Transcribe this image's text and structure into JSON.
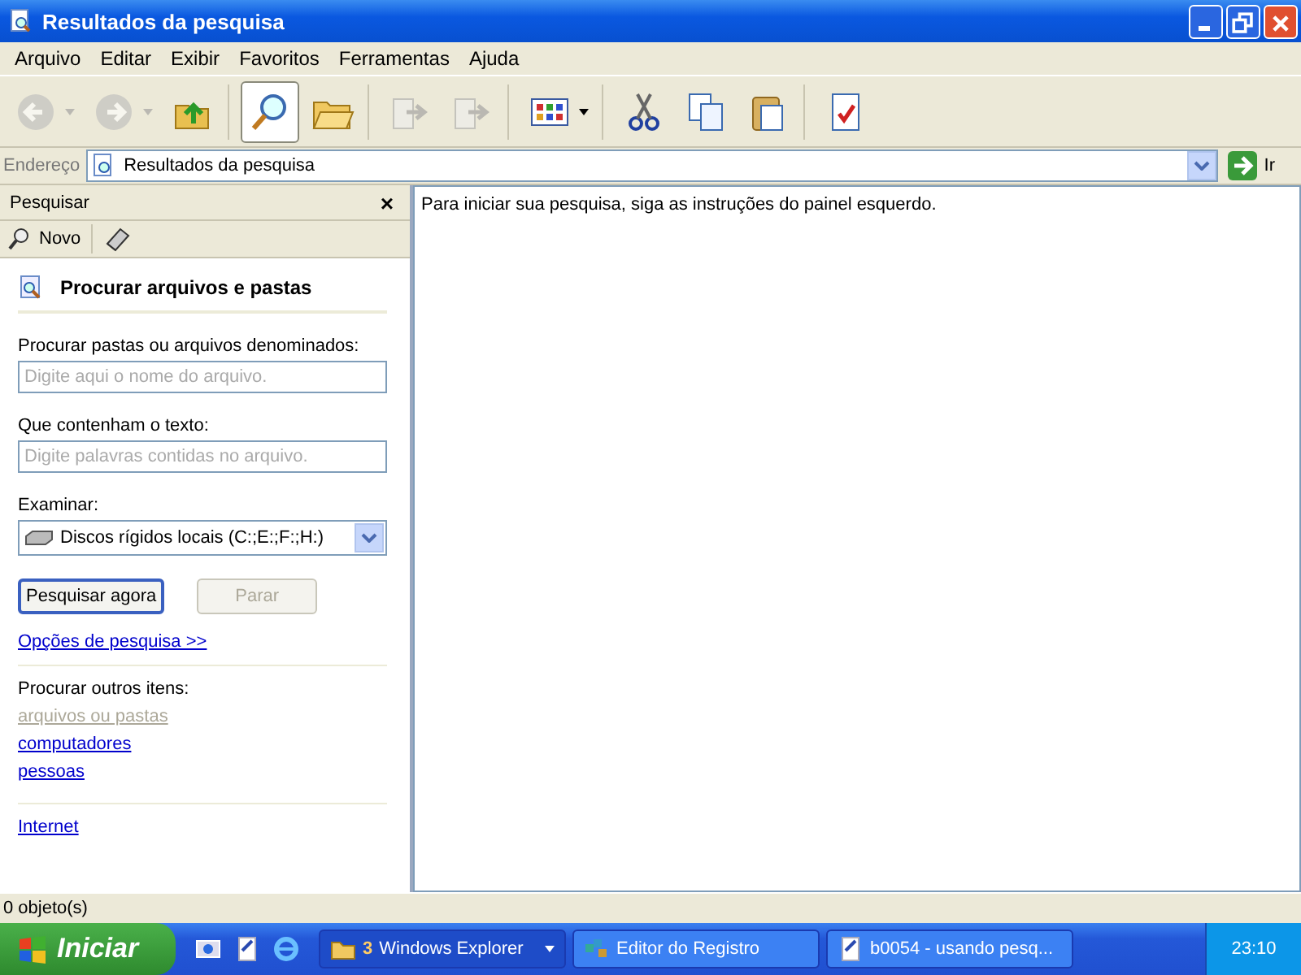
{
  "window": {
    "title": "Resultados da pesquisa"
  },
  "menu": [
    "Arquivo",
    "Editar",
    "Exibir",
    "Favoritos",
    "Ferramentas",
    "Ajuda"
  ],
  "toolbar": [
    {
      "kind": "back",
      "disabled": true,
      "selected": false,
      "separator_before": false
    },
    {
      "kind": "forward",
      "disabled": true,
      "selected": false,
      "separator_before": false
    },
    {
      "kind": "up",
      "disabled": false,
      "selected": false,
      "separator_before": false
    },
    {
      "kind": "search",
      "disabled": false,
      "selected": true,
      "separator_before": true
    },
    {
      "kind": "folders",
      "disabled": false,
      "selected": false,
      "separator_before": false
    },
    {
      "kind": "move",
      "disabled": true,
      "selected": false,
      "separator_before": true
    },
    {
      "kind": "copyto",
      "disabled": true,
      "selected": false,
      "separator_before": false
    },
    {
      "kind": "views",
      "disabled": false,
      "selected": false,
      "separator_before": true
    },
    {
      "kind": "cut",
      "disabled": false,
      "selected": false,
      "separator_before": true
    },
    {
      "kind": "copy",
      "disabled": false,
      "selected": false,
      "separator_before": false
    },
    {
      "kind": "paste",
      "disabled": false,
      "selected": false,
      "separator_before": false
    },
    {
      "kind": "properties",
      "disabled": false,
      "selected": false,
      "separator_before": true
    }
  ],
  "address": {
    "label": "Endereço",
    "value": "Resultados da pesquisa",
    "go": "Ir"
  },
  "search_pane": {
    "title": "Pesquisar",
    "close": "×",
    "new_button": "Novo",
    "heading": "Procurar arquivos e pastas",
    "name_label": "Procurar pastas ou arquivos denominados:",
    "name_placeholder": "Digite aqui o nome do arquivo.",
    "text_label": "Que contenham o texto:",
    "text_placeholder": "Digite palavras contidas no arquivo.",
    "look_in_label": "Examinar:",
    "look_in_value": "Discos rígidos locais (C:;E:;F:;H:)",
    "buttons": [
      {
        "label": "Pesquisar agora",
        "disabled": false
      },
      {
        "label": "Parar",
        "disabled": true
      }
    ],
    "options_link": "Opções de pesquisa  >>",
    "other_label": "Procurar outros itens:",
    "other_links": [
      {
        "label": "arquivos ou pastas",
        "disabled": true
      },
      {
        "label": "computadores",
        "disabled": false
      },
      {
        "label": "pessoas",
        "disabled": false
      }
    ],
    "internet_link": "Internet"
  },
  "results": {
    "message": "Para iniciar sua pesquisa, siga as instruções do painel esquerdo."
  },
  "status_bar": "0 objeto(s)",
  "taskbar": {
    "start": "Iniciar",
    "tasks": [
      {
        "count": "3",
        "label": "Windows Explorer",
        "selected": true,
        "kind": "folder"
      },
      {
        "label": "Editor do Registro",
        "selected": false,
        "kind": "registry"
      },
      {
        "label": "b0054 - usando pesq...",
        "selected": false,
        "kind": "notepad"
      }
    ],
    "clock": "23:10"
  }
}
